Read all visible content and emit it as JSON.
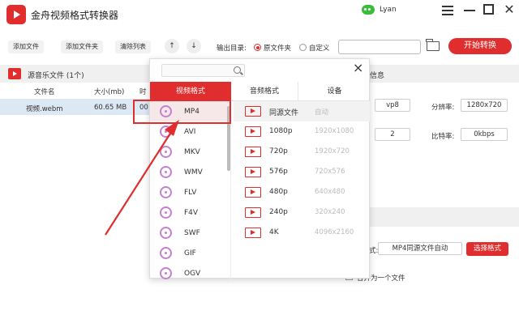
{
  "app": {
    "title": "金舟视频格式转换器",
    "user": "Lyan"
  },
  "toolbar": {
    "add_file": "添加文件",
    "add_folder": "添加文件夹",
    "clear_list": "清除列表",
    "up_arrow": "↑",
    "down_arrow": "↓",
    "output_dir_label": "输出目录:",
    "option_source": "原文件夹",
    "option_custom": "自定义",
    "start": "开始转换"
  },
  "file_panel": {
    "header": "源音乐文件 (1个)",
    "columns": [
      "文件名",
      "大小(mb)",
      "时"
    ],
    "rows": [
      {
        "name": "视频.webm",
        "size": "60.65 MB",
        "time": "00"
      }
    ]
  },
  "info_panel": {
    "header": "信息",
    "codec": "vp8",
    "resolution_label": "分辨率:",
    "resolution": "1280x720",
    "channels": "2",
    "bitrate_label": "比特率:",
    "bitrate": "0kbps",
    "format_label_tail": "式:",
    "format_value": "MP4同源文件自动",
    "select_format": "选择格式",
    "merge_label": "合并为一个文件"
  },
  "popup": {
    "close": "×",
    "tabs": [
      "视频格式",
      "音频格式",
      "设备"
    ],
    "formats": [
      "MP4",
      "AVI",
      "MKV",
      "WMV",
      "FLV",
      "F4V",
      "SWF",
      "GIF",
      "OGV"
    ],
    "qualities": [
      {
        "name": "同源文件",
        "res": "自动"
      },
      {
        "name": "1080p",
        "res": "1920x1080"
      },
      {
        "name": "720p",
        "res": "1920x720"
      },
      {
        "name": "576p",
        "res": "720x576"
      },
      {
        "name": "480p",
        "res": "640x480"
      },
      {
        "name": "240p",
        "res": "320x240"
      },
      {
        "name": "4K",
        "res": "4096x2160"
      }
    ]
  },
  "colors": {
    "accent": "#e02d2d",
    "selected_row": "#dde8f5",
    "disc": "#c580d0"
  }
}
